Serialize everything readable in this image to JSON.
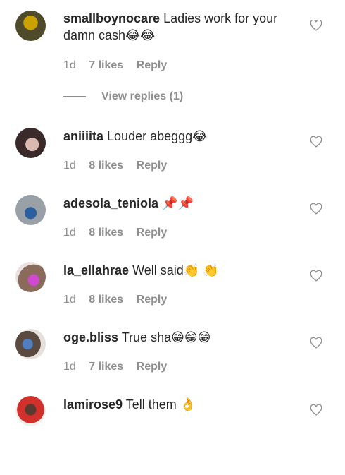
{
  "comments": [
    {
      "username": "smallboynocare",
      "text": "Ladies work for your damn cash",
      "emoji": "😂😂",
      "time": "1d",
      "likes": "7 likes",
      "reply": "Reply",
      "view_replies": "View replies (1)"
    },
    {
      "username": "aniiiita",
      "text": "Louder abeggg",
      "emoji": "😂",
      "time": "1d",
      "likes": "8 likes",
      "reply": "Reply"
    },
    {
      "username": "adesola_teniola",
      "text": "",
      "emoji": "📌📌",
      "time": "1d",
      "likes": "8 likes",
      "reply": "Reply"
    },
    {
      "username": "la_ellahrae",
      "text": "Well said",
      "emoji": "👏 👏",
      "time": "1d",
      "likes": "8 likes",
      "reply": "Reply"
    },
    {
      "username": "oge.bliss",
      "text": "True sha",
      "emoji": "😁😁😁",
      "time": "1d",
      "likes": "7 likes",
      "reply": "Reply"
    },
    {
      "username": "lamirose9",
      "text": "Tell them",
      "emoji": "👌",
      "time": "",
      "likes": "",
      "reply": ""
    }
  ]
}
